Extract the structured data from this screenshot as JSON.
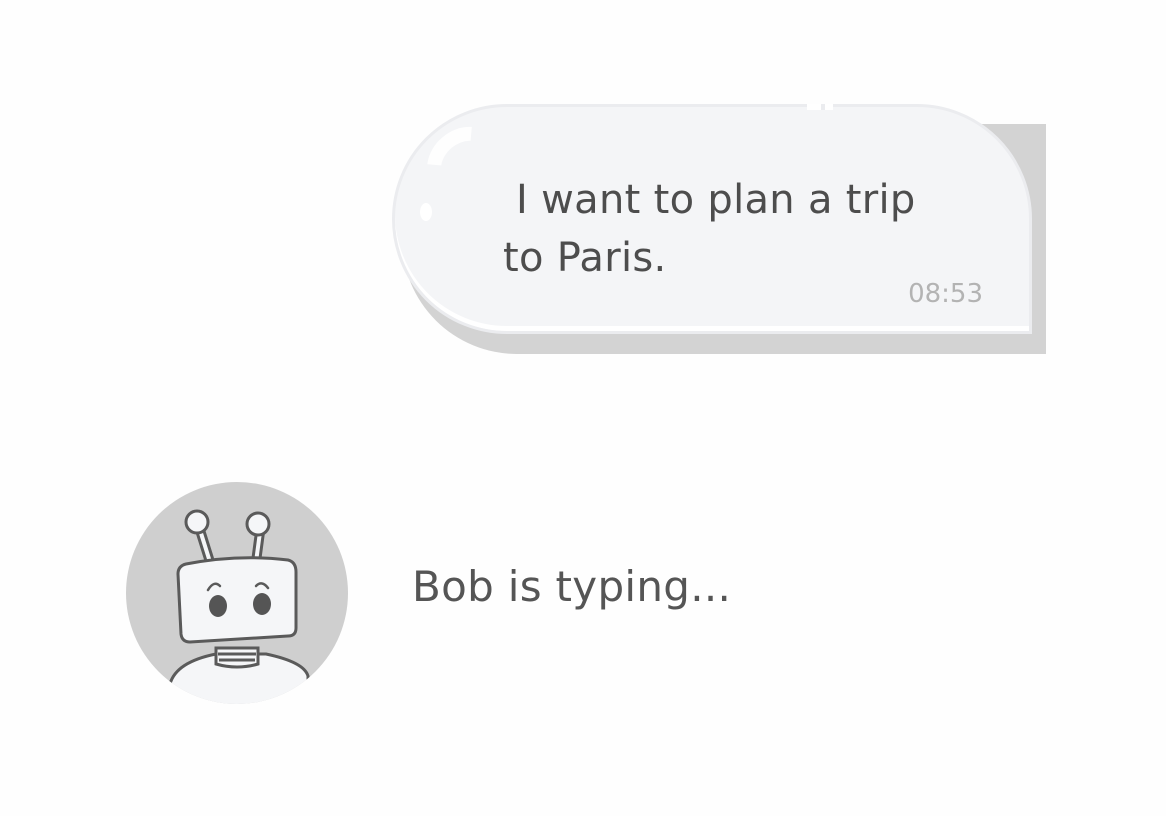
{
  "conversation": {
    "outgoing_message": {
      "text": " I want to plan a trip\nto Paris.",
      "time": "08:53"
    },
    "typing_indicator": {
      "avatar_icon": "robot-icon",
      "text": "Bob is typing..."
    }
  },
  "colors": {
    "background": "#fefefe",
    "bubble_fill": "#f4f5f7",
    "bubble_shadow": "#d3d3d3",
    "text": "#4d4d4d",
    "timestamp": "#b3b3b3",
    "avatar_bg": "#cfcfcf"
  }
}
